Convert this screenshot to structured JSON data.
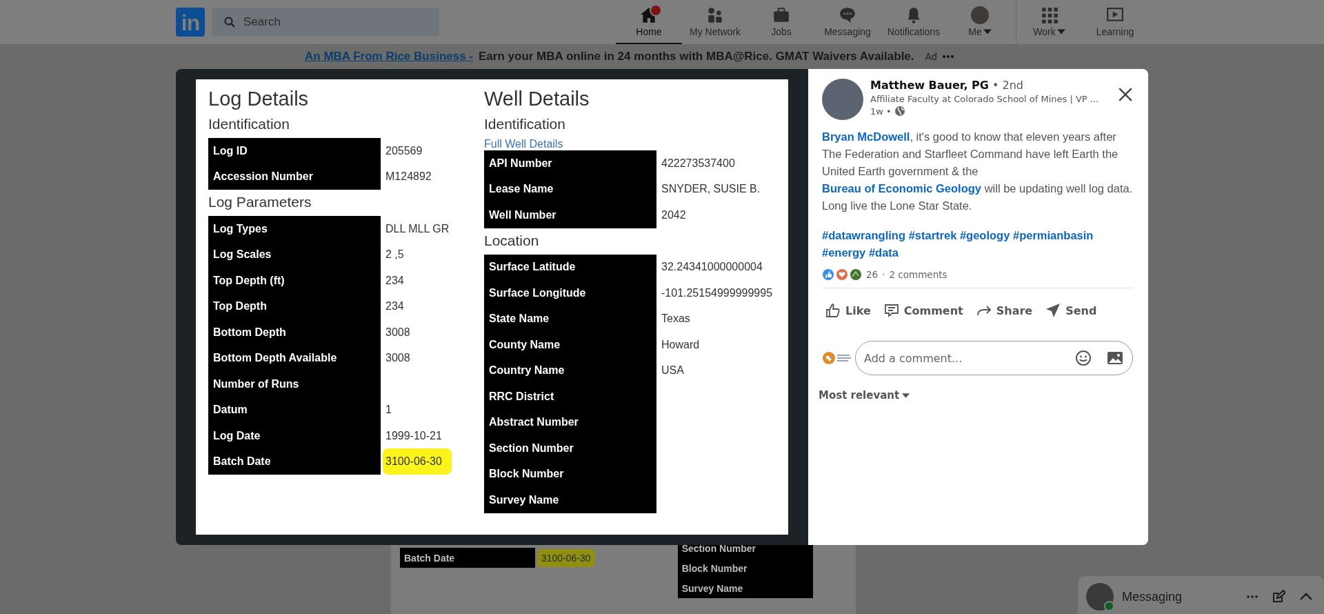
{
  "nav": {
    "logo": "in",
    "search": {
      "placeholder": "Search"
    },
    "items": [
      {
        "label": "Home",
        "kind": "home",
        "selected": true,
        "notification": true,
        "dropdown": false
      },
      {
        "label": "My Network",
        "kind": "network",
        "selected": false,
        "notification": false,
        "dropdown": false
      },
      {
        "label": "Jobs",
        "kind": "jobs",
        "selected": false,
        "notification": false,
        "dropdown": false
      },
      {
        "label": "Messaging",
        "kind": "messaging",
        "selected": false,
        "notification": false,
        "dropdown": false
      },
      {
        "label": "Notifications",
        "kind": "bell",
        "selected": false,
        "notification": false,
        "dropdown": false
      },
      {
        "label": "Me",
        "kind": "me",
        "selected": false,
        "notification": false,
        "dropdown": true
      },
      {
        "label": "Work",
        "kind": "grid",
        "selected": false,
        "notification": false,
        "dropdown": true
      },
      {
        "label": "Learning",
        "kind": "learning",
        "selected": false,
        "notification": false,
        "dropdown": false
      }
    ]
  },
  "ad": {
    "link": "An MBA From Rice Business -",
    "text": "Earn your MBA online in 24 months with MBA@Rice. GMAT Waivers Available.",
    "label": "Ad"
  },
  "feed_card": {
    "left_rows": [
      {
        "label": "Batch Date",
        "value": "3100-06-30",
        "highlighted": true
      }
    ],
    "right_rows": [
      {
        "label": "Section Number"
      },
      {
        "label": "Block Number"
      },
      {
        "label": "Survey Name"
      }
    ]
  },
  "document": {
    "columns": [
      {
        "title": "Log Details",
        "sections": [
          {
            "heading": "Identification",
            "rows": [
              {
                "label": "Log ID",
                "value": "205569",
                "highlighted": false
              },
              {
                "label": "Accession Number",
                "value": "M124892",
                "highlighted": false
              }
            ]
          },
          {
            "heading": "Log Parameters",
            "rows": [
              {
                "label": "Log Types",
                "value": "DLL MLL GR",
                "highlighted": false
              },
              {
                "label": "Log Scales",
                "value": "2 ,5",
                "highlighted": false
              },
              {
                "label": "Top Depth (ft)",
                "value": "234",
                "highlighted": false
              },
              {
                "label": "Top Depth",
                "value": "234",
                "highlighted": false
              },
              {
                "label": "Bottom Depth",
                "value": "3008",
                "highlighted": false
              },
              {
                "label": "Bottom Depth Available",
                "value": "3008",
                "highlighted": false
              },
              {
                "label": "Number of Runs",
                "highlighted": false
              },
              {
                "label": "Datum",
                "value": "1",
                "highlighted": false
              },
              {
                "label": "Log Date",
                "value": "1999-10-21",
                "highlighted": false
              },
              {
                "label": "Batch Date",
                "value": "3100-06-30",
                "highlighted": true
              }
            ]
          }
        ]
      },
      {
        "title": "Well Details",
        "sections": [
          {
            "heading": "Identification",
            "link": "Full Well Details",
            "rows": [
              {
                "label": "API Number",
                "value": "422273537400",
                "highlighted": false
              },
              {
                "label": "Lease Name",
                "value": "SNYDER, SUSIE B.",
                "highlighted": false
              },
              {
                "label": "Well Number",
                "value": "2042",
                "highlighted": false
              }
            ]
          },
          {
            "heading": "Location",
            "rows": [
              {
                "label": "Surface Latitude",
                "value": "32.24341000000004",
                "highlighted": false
              },
              {
                "label": "Surface Longitude",
                "value": "-101.25154999999995",
                "highlighted": false
              },
              {
                "label": "State Name",
                "value": "Texas",
                "highlighted": false
              },
              {
                "label": "County Name",
                "value": "Howard",
                "highlighted": false
              },
              {
                "label": "Country Name",
                "value": "USA",
                "highlighted": false
              },
              {
                "label": "RRC District",
                "highlighted": false
              },
              {
                "label": "Abstract Number",
                "highlighted": false
              },
              {
                "label": "Section Number",
                "highlighted": false
              },
              {
                "label": "Block Number",
                "highlighted": false
              },
              {
                "label": "Survey Name",
                "highlighted": false
              }
            ]
          }
        ]
      }
    ]
  },
  "post": {
    "author": "Matthew Bauer, PG",
    "degree": "• 2nd",
    "headline": "Affiliate Faculty at Colorado School of Mines | VP ...",
    "time": "1w •",
    "body": [
      {
        "kind": "mention",
        "text": "Bryan McDowell"
      },
      {
        "kind": "text",
        "text": ", it's good to know that eleven years after The Federation and Starfleet Command have left Earth the United Earth government & the "
      },
      {
        "kind": "mention",
        "text": "Bureau of Economic Geology"
      },
      {
        "kind": "text",
        "text": " will be updating well log data. Long live the Lone Star State."
      }
    ],
    "hashtags": [
      "#datawrangling",
      "#startrek",
      "#geology",
      "#permianbasin",
      "#energy",
      "#data"
    ],
    "reaction_count": "26",
    "separator": "·",
    "comments": "2 comments",
    "actions": [
      {
        "label": "Like",
        "kind": "like"
      },
      {
        "label": "Comment",
        "kind": "comment"
      },
      {
        "label": "Share",
        "kind": "share"
      },
      {
        "label": "Send",
        "kind": "send"
      }
    ],
    "comment_field": {
      "placeholder": "Add a comment..."
    },
    "sort": "Most relevant"
  },
  "messaging": {
    "label": "Messaging",
    "online": true
  }
}
